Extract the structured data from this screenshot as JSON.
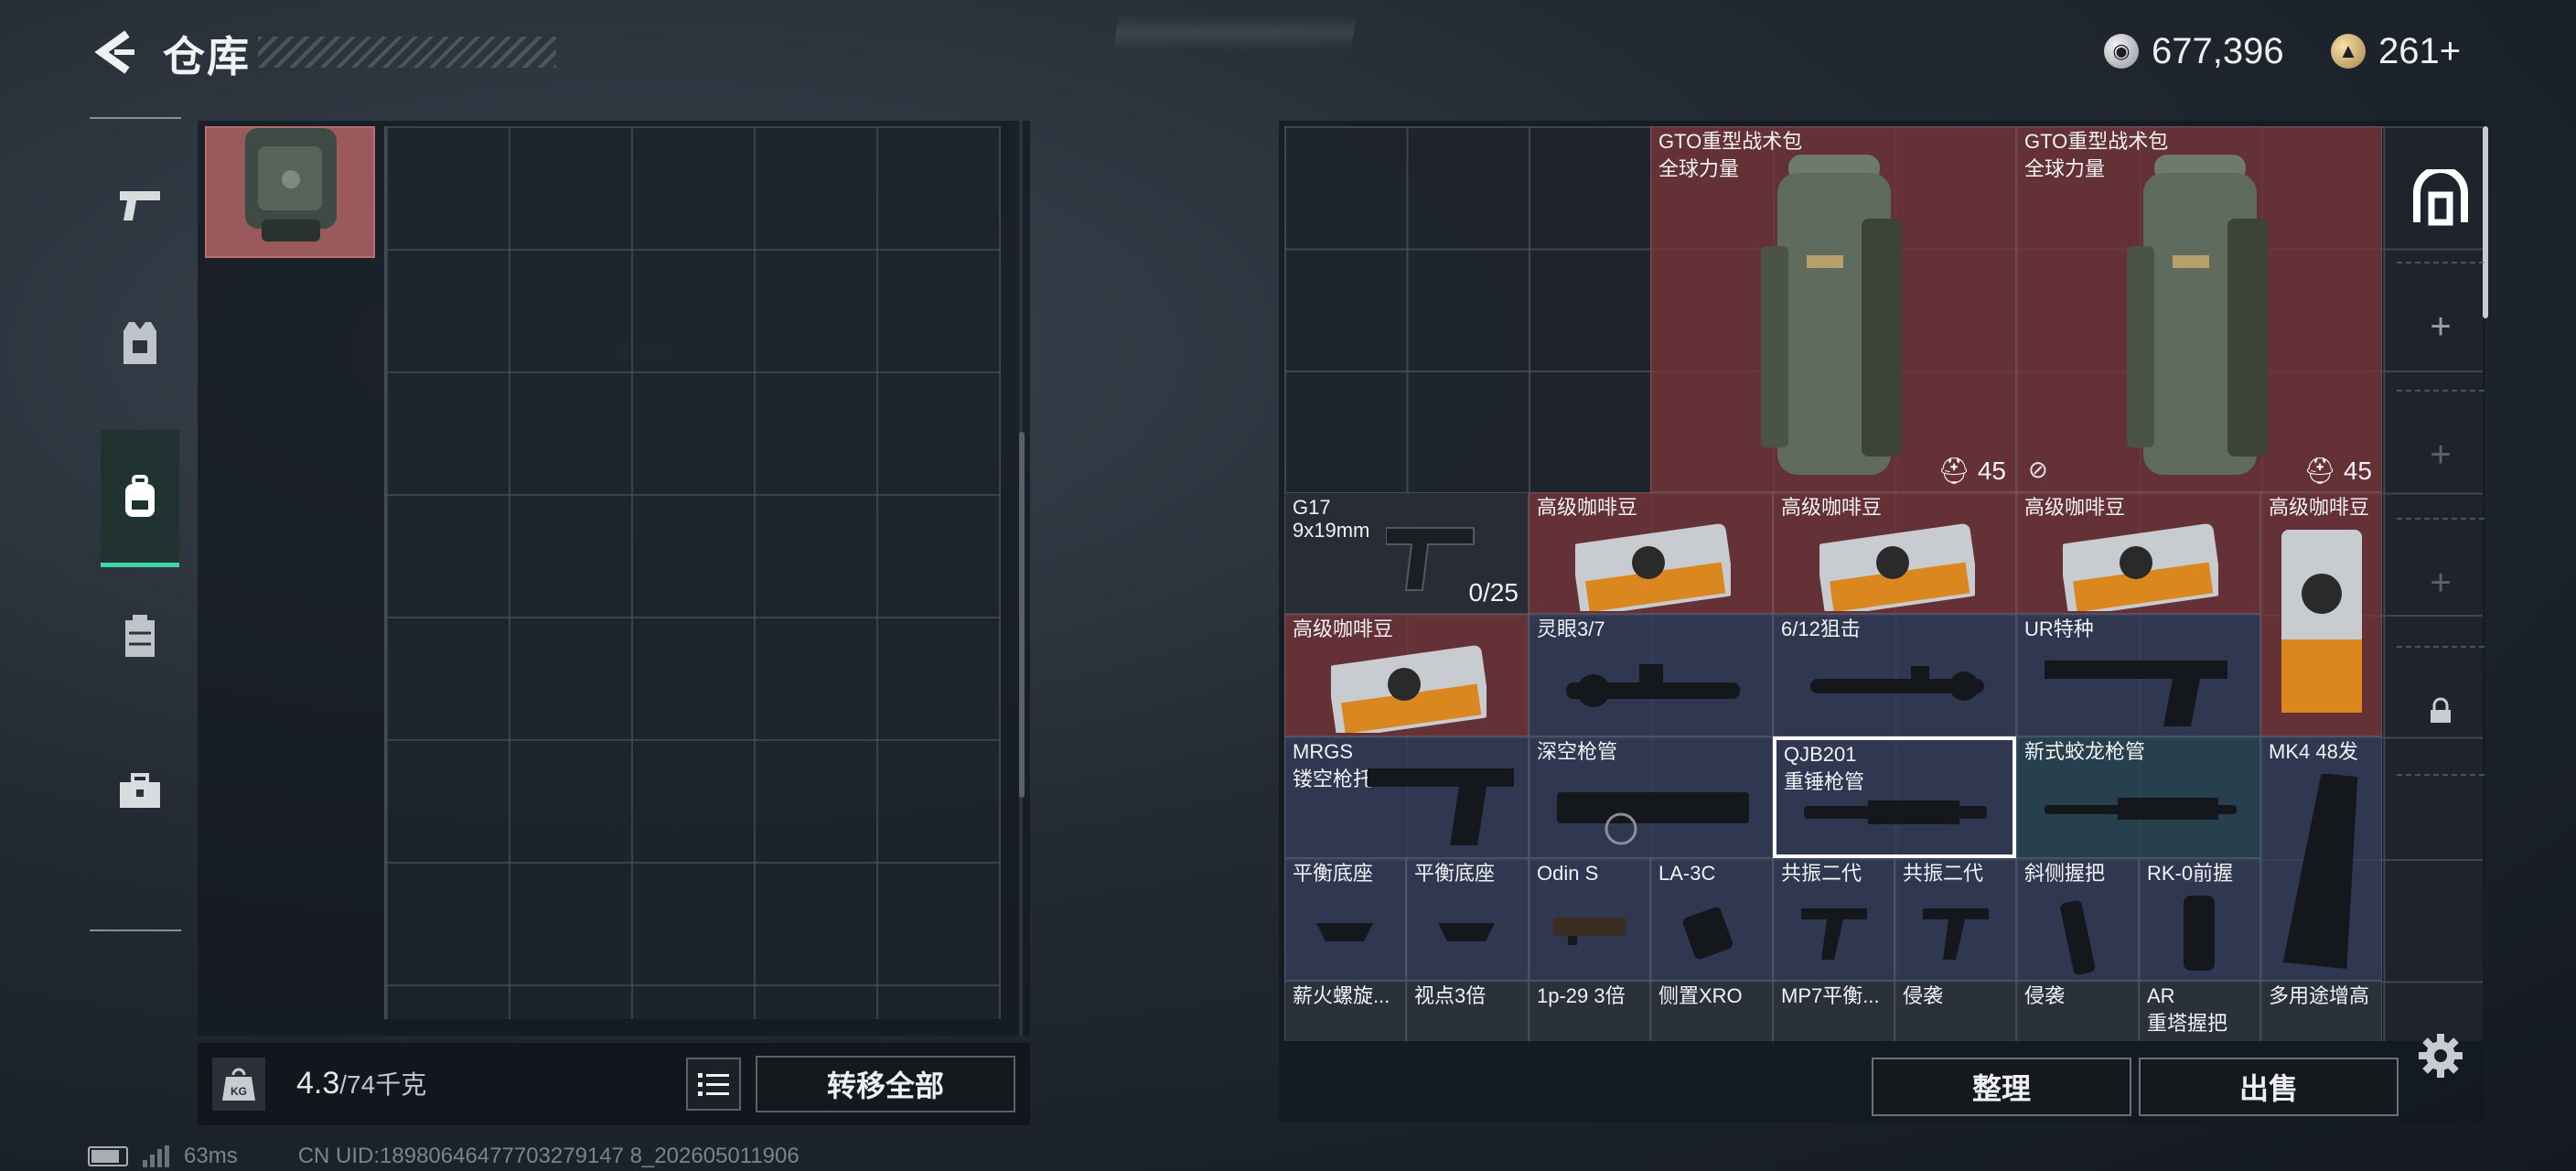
{
  "header": {
    "title": "仓库",
    "currencies": [
      {
        "icon": "silver-coin-icon",
        "value": "677,396"
      },
      {
        "icon": "gold-coin-icon",
        "value": "261+"
      }
    ]
  },
  "rail": {
    "categories": [
      {
        "icon": "pistol-icon"
      },
      {
        "icon": "armor-vest-icon"
      },
      {
        "icon": "backpack-icon",
        "active": true
      },
      {
        "icon": "chest-rig-icon"
      },
      {
        "icon": "toolbox-icon"
      }
    ]
  },
  "left_panel": {
    "weight_icon": "kg-weight-icon",
    "weight_current": "4.3",
    "weight_max": "/74千克",
    "list_button_icon": "list-icon",
    "transfer_label": "转移全部"
  },
  "warehouse": {
    "items": [
      {
        "name": "GTO重型战术包",
        "sub": "全球力量",
        "qty": "45",
        "qty_icon": "helmet-icon",
        "color": "red"
      },
      {
        "name": "GTO重型战术包",
        "sub": "全球力量",
        "qty": "45",
        "qty_icon": "helmet-icon",
        "flag_icon": "no-insure-icon",
        "color": "red"
      },
      {
        "name": "G17",
        "sub": "9x19mm",
        "qty": "0/25",
        "color": "dark"
      },
      {
        "name": "高级咖啡豆",
        "color": "red"
      },
      {
        "name": "高级咖啡豆",
        "color": "red"
      },
      {
        "name": "高级咖啡豆",
        "color": "red"
      },
      {
        "name": "高级咖啡豆",
        "color": "red"
      },
      {
        "name": "高级咖啡豆",
        "color": "red"
      },
      {
        "name": "灵眼3/7",
        "color": "blue"
      },
      {
        "name": "6/12狙击",
        "color": "blue"
      },
      {
        "name": "UR特种",
        "color": "blue"
      },
      {
        "name": "MRGS",
        "sub": "镂空枪托",
        "color": "blue"
      },
      {
        "name": "深空枪管",
        "color": "blue"
      },
      {
        "name": "QJB201",
        "sub": "重锤枪管",
        "color": "blue",
        "selected": true
      },
      {
        "name": "新式蛟龙枪管",
        "color": "teal"
      },
      {
        "name": "MK4 48发",
        "color": "blue"
      },
      {
        "name": "平衡底座",
        "color": "blue"
      },
      {
        "name": "平衡底座",
        "color": "blue"
      },
      {
        "name": "Odin S",
        "color": "blue"
      },
      {
        "name": "LA-3C",
        "color": "blue"
      },
      {
        "name": "共振二代",
        "color": "blue"
      },
      {
        "name": "共振二代",
        "color": "blue"
      },
      {
        "name": "斜侧握把",
        "color": "blue"
      },
      {
        "name": "RK-0前握",
        "color": "blue"
      },
      {
        "name": "薪火螺旋...",
        "color": "gray"
      },
      {
        "name": "视点3倍",
        "color": "gray"
      },
      {
        "name": "1p-29 3倍",
        "color": "gray"
      },
      {
        "name": "侧置XRO",
        "color": "gray"
      },
      {
        "name": "MP7平衡...",
        "color": "gray"
      },
      {
        "name": "侵袭",
        "color": "gray"
      },
      {
        "name": "侵袭",
        "color": "gray"
      },
      {
        "name": "AR",
        "sub": "重塔握把",
        "color": "gray"
      },
      {
        "name": "多用途增高",
        "color": "gray"
      }
    ],
    "sort_label": "整理",
    "sell_label": "出售"
  },
  "page_tabs": [
    {
      "icon": "warehouse-home-icon"
    },
    {
      "icon": "plus-icon"
    },
    {
      "icon": "plus-icon"
    },
    {
      "icon": "plus-icon"
    },
    {
      "icon": "lock-icon"
    }
  ],
  "status": {
    "ping": "63ms",
    "uid": "CN UID:18980646477703279147 8_202605011906"
  },
  "colors": {
    "accent": "#3dd6a8",
    "rare_red": "#783a3a",
    "uncommon_blue": "#363e5c"
  }
}
